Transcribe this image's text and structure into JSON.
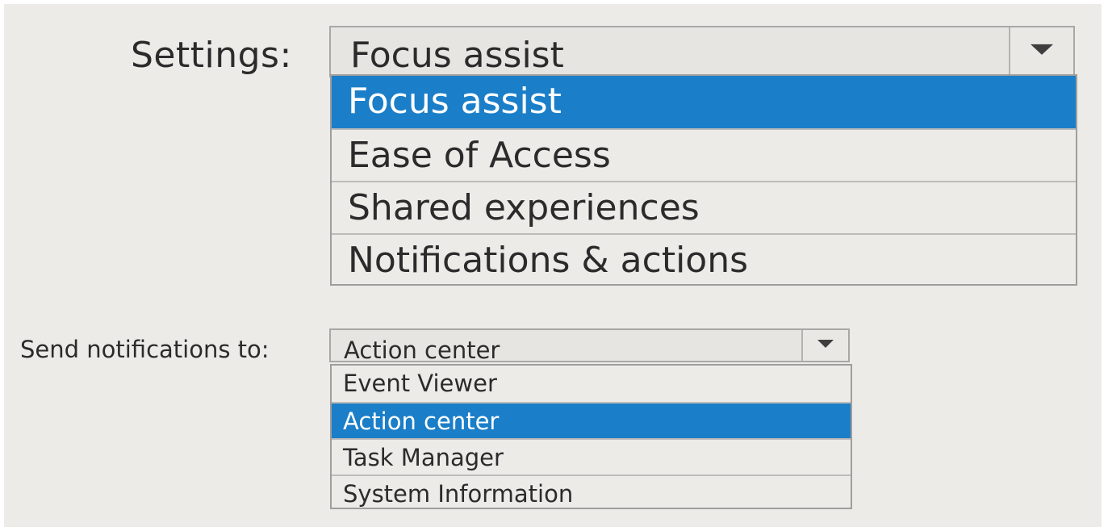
{
  "settings": {
    "label": "Settings:",
    "selected_value": "Focus assist",
    "options": [
      {
        "label": "Focus assist",
        "selected": true
      },
      {
        "label": "Ease of Access",
        "selected": false
      },
      {
        "label": "Shared experiences",
        "selected": false
      },
      {
        "label": "Notifications & actions",
        "selected": false
      }
    ]
  },
  "send_notifications": {
    "label": "Send notifications to:",
    "selected_value": "Action center",
    "options": [
      {
        "label": "Event Viewer",
        "selected": false
      },
      {
        "label": "Action center",
        "selected": true
      },
      {
        "label": "Task Manager",
        "selected": false
      },
      {
        "label": "System Information",
        "selected": false
      }
    ]
  },
  "colors": {
    "selection": "#1b7ec8",
    "background": "#ecebe8"
  },
  "icons": {
    "dropdown": "chevron-down-icon"
  }
}
